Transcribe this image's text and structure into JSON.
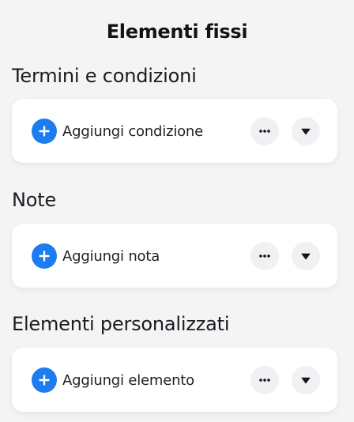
{
  "panel": {
    "title": "Elementi fissi"
  },
  "sections": [
    {
      "title": "Termini e condizioni",
      "add_label": "Aggiungi condizione",
      "icons": {
        "add": "plus-circle-icon",
        "more": "more-horizontal-icon",
        "toggle": "caret-down-icon"
      }
    },
    {
      "title": "Note",
      "add_label": "Aggiungi nota",
      "icons": {
        "add": "plus-circle-icon",
        "more": "more-horizontal-icon",
        "toggle": "caret-down-icon"
      }
    },
    {
      "title": "Elementi personalizzati",
      "add_label": "Aggiungi elemento",
      "icons": {
        "add": "plus-circle-icon",
        "more": "more-horizontal-icon",
        "toggle": "caret-down-icon"
      }
    }
  ],
  "colors": {
    "accent": "#1d7df0",
    "background": "#f4f4f5",
    "card": "#ffffff",
    "icon_button_bg": "#f1f1f3"
  }
}
